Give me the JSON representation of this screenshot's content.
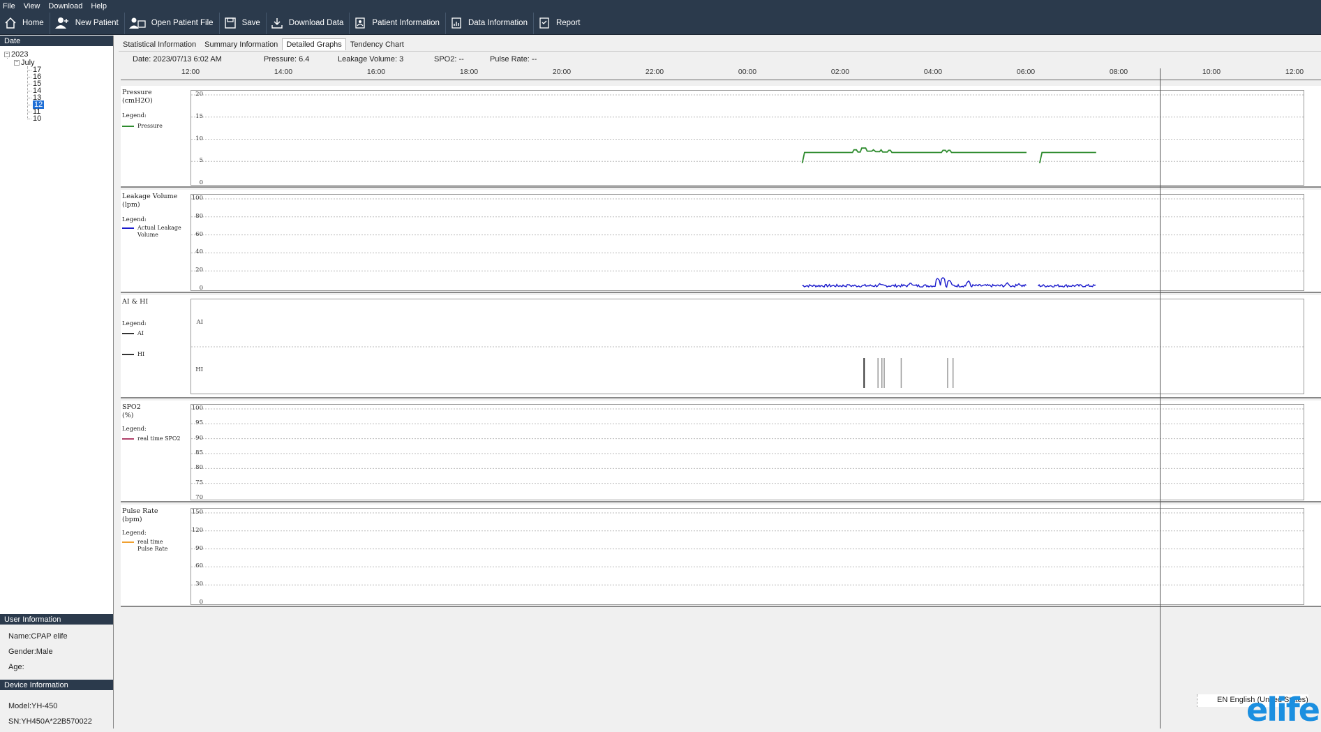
{
  "menu": [
    "File",
    "View",
    "Download",
    "Help"
  ],
  "toolbar": [
    {
      "label": "Home",
      "icon": "home-icon"
    },
    {
      "label": "New Patient",
      "icon": "new-patient-icon"
    },
    {
      "label": "Open Patient File",
      "icon": "open-patient-icon"
    },
    {
      "label": "Save",
      "icon": "save-icon"
    },
    {
      "label": "Download Data",
      "icon": "download-icon"
    },
    {
      "label": "Patient Information",
      "icon": "patient-info-icon"
    },
    {
      "label": "Data Information",
      "icon": "data-info-icon"
    },
    {
      "label": "Report",
      "icon": "report-icon"
    }
  ],
  "date_panel": {
    "header": "Date",
    "year": "2023",
    "month": "July",
    "days": [
      "17",
      "16",
      "15",
      "14",
      "13",
      "12",
      "11",
      "10"
    ],
    "selected_day": "12"
  },
  "user_info": {
    "header": "User Information",
    "name_label": "Name:",
    "name": "CPAP elife",
    "gender_label": "Gender:",
    "gender": "Male",
    "age_label": "Age:",
    "age": ""
  },
  "device_info": {
    "header": "Device Information",
    "model_label": "Model:",
    "model": "YH-450",
    "sn_label": "SN:",
    "sn": "YH450A*22B570022"
  },
  "tabs": [
    {
      "label": "Statistical Information",
      "active": false
    },
    {
      "label": "Summary Information",
      "active": false
    },
    {
      "label": "Detailed Graphs",
      "active": true
    },
    {
      "label": "Tendency Chart",
      "active": false
    }
  ],
  "status": {
    "date": "Date: 2023/07/13 6:02 AM",
    "pressure": "Pressure: 6.4",
    "leakage": "Leakage Volume: 3",
    "spo2": "SPO2: --",
    "pulse": "Pulse Rate: --"
  },
  "time_axis": [
    "12:00",
    "14:00",
    "16:00",
    "18:00",
    "20:00",
    "22:00",
    "00:00",
    "02:00",
    "04:00",
    "06:00",
    "08:00",
    "10:00",
    "12:00"
  ],
  "colors": {
    "pressure": "#2e8b2e",
    "leakage": "#1a1acc",
    "ai": "#333333",
    "hi": "#999999",
    "spo2": "#b0406a",
    "pulse": "#f0a030",
    "toolbar_bg": "#2b3a4c",
    "selected": "#1f6fd6",
    "brand": "#1b8fe0"
  },
  "charts": {
    "pressure": {
      "title": "Pressure",
      "unit": "(cmH2O)",
      "legend_label": "Legend:",
      "legend": "Pressure",
      "yticks": [
        "20",
        "15",
        "10",
        "5",
        "0"
      ],
      "ylim": [
        0,
        20
      ]
    },
    "leakage": {
      "title": "Leakage Volume",
      "unit": "(lpm)",
      "legend_label": "Legend:",
      "legend_line1": "Actual Leakage",
      "legend_line2": "Volume",
      "yticks": [
        "100",
        "80",
        "60",
        "40",
        "20",
        "0"
      ],
      "ylim": [
        0,
        100
      ]
    },
    "aihi": {
      "title": "AI & HI",
      "legend_label": "Legend:",
      "legend_ai": "AI",
      "legend_hi": "HI",
      "yticks": [
        "AI",
        "HI"
      ]
    },
    "spo2": {
      "title": "SPO2",
      "unit": "(%)",
      "legend_label": "Legend:",
      "legend": "real time SPO2",
      "yticks": [
        "100",
        "95",
        "90",
        "85",
        "80",
        "75",
        "70"
      ],
      "ylim": [
        70,
        100
      ]
    },
    "pulse": {
      "title": "Pulse Rate",
      "unit": "(bpm)",
      "legend_label": "Legend:",
      "legend_line1": "real time",
      "legend_line2": "Pulse Rate",
      "yticks": [
        "150",
        "120",
        "90",
        "60",
        "30",
        "0"
      ],
      "ylim": [
        0,
        150
      ]
    }
  },
  "series": {
    "pressure": [
      [
        "01:10",
        4.6
      ],
      [
        "01:13",
        7.0
      ],
      [
        "02:15",
        7.0
      ],
      [
        "02:17",
        7.6
      ],
      [
        "02:20",
        7.6
      ],
      [
        "02:22",
        7.1
      ],
      [
        "02:25",
        7.1
      ],
      [
        "02:27",
        8.0
      ],
      [
        "02:32",
        8.0
      ],
      [
        "02:34",
        7.3
      ],
      [
        "02:40",
        7.3
      ],
      [
        "02:42",
        7.6
      ],
      [
        "02:45",
        7.2
      ],
      [
        "02:50",
        7.2
      ],
      [
        "02:52",
        7.6
      ],
      [
        "02:54",
        7.1
      ],
      [
        "03:00",
        7.1
      ],
      [
        "03:02",
        7.5
      ],
      [
        "03:04",
        7.5
      ],
      [
        "03:06",
        7.0
      ],
      [
        "04:10",
        7.0
      ],
      [
        "04:12",
        7.5
      ],
      [
        "04:15",
        7.5
      ],
      [
        "04:17",
        7.1
      ],
      [
        "04:19",
        7.5
      ],
      [
        "04:21",
        7.5
      ],
      [
        "04:23",
        7.0
      ],
      [
        "06:00",
        7.0
      ],
      null,
      [
        "06:17",
        4.6
      ],
      [
        "06:20",
        7.0
      ],
      [
        "07:30",
        7.0
      ]
    ],
    "leakage_segments": [
      [
        "01:10",
        "06:00"
      ],
      [
        "06:15",
        "07:30"
      ]
    ],
    "leakage_base": 2,
    "leakage_peaks": [
      [
        "02:10",
        5
      ],
      [
        "02:50",
        6
      ],
      [
        "03:30",
        7
      ],
      [
        "04:05",
        12
      ],
      [
        "04:12",
        13
      ],
      [
        "04:20",
        10
      ],
      [
        "04:45",
        9
      ],
      [
        "05:35",
        7
      ],
      [
        "05:50",
        6
      ]
    ],
    "ai_events": [],
    "hi_events": [
      "02:30",
      "02:48",
      "02:53",
      "02:56",
      "03:18",
      "04:18",
      "04:25"
    ]
  },
  "cursor_time": "06:02",
  "language_bar": "EN English (United States)",
  "brand_text": "elife"
}
